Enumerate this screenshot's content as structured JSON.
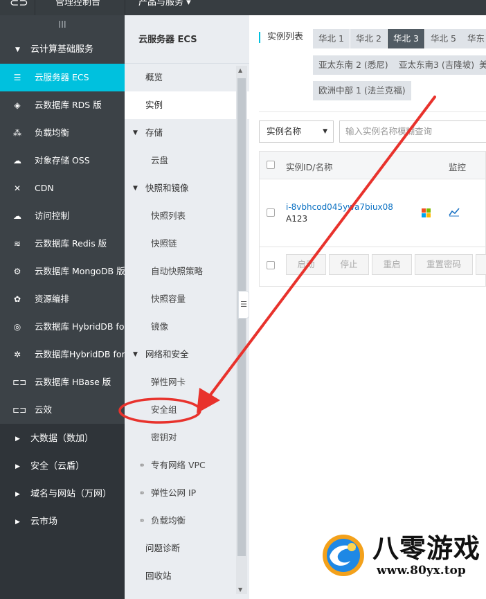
{
  "topbar": {
    "console": "管理控制台",
    "products": "产品与服务 ▾"
  },
  "sidebar": {
    "collapse_icon": "III",
    "group_title": "云计算基础服务",
    "items": [
      {
        "label": "云服务器 ECS",
        "icon": "server-icon",
        "glyph": "☰"
      },
      {
        "label": "云数据库 RDS 版",
        "icon": "database-icon",
        "glyph": "◈"
      },
      {
        "label": "负载均衡",
        "icon": "load-balance-icon",
        "glyph": "⁂"
      },
      {
        "label": "对象存储 OSS",
        "icon": "oss-icon",
        "glyph": "☁"
      },
      {
        "label": "CDN",
        "icon": "cdn-icon",
        "glyph": "✕"
      },
      {
        "label": "访问控制",
        "icon": "access-control-icon",
        "glyph": "☁"
      },
      {
        "label": "云数据库 Redis 版",
        "icon": "redis-icon",
        "glyph": "≋"
      },
      {
        "label": "云数据库 MongoDB 版",
        "icon": "mongodb-icon",
        "glyph": "⚙"
      },
      {
        "label": "资源编排",
        "icon": "orchestration-icon",
        "glyph": "✿"
      },
      {
        "label": "云数据库 HybridDB fo...",
        "icon": "hybriddb-icon",
        "glyph": "◎"
      },
      {
        "label": "云数据库HybridDB for...",
        "icon": "hybriddb2-icon",
        "glyph": "✲"
      },
      {
        "label": "云数据库 HBase 版",
        "icon": "hbase-icon",
        "glyph": "⊏⊐"
      },
      {
        "label": "云效",
        "icon": "yunxiao-icon",
        "glyph": "⊏⊐"
      }
    ],
    "groups": [
      "大数据（数加）",
      "安全（云盾）",
      "域名与网站（万网）",
      "云市场"
    ]
  },
  "prodnav": {
    "title": "云服务器 ECS",
    "overview": "概览",
    "instances": "实例",
    "storage": "存储",
    "disk": "云盘",
    "snapshot_group": "快照和镜像",
    "snapshot_list": "快照列表",
    "snapshot_chain": "快照链",
    "auto_snapshot": "自动快照策略",
    "snapshot_capacity": "快照容量",
    "image": "镜像",
    "network_group": "网络和安全",
    "eni": "弹性网卡",
    "security_group": "安全组",
    "keypair": "密钥对",
    "vpc": "专有网络 VPC",
    "eip": "弹性公网 IP",
    "slb": "负载均衡",
    "diagnosis": "问题诊断",
    "recycle": "回收站"
  },
  "main": {
    "list_title": "实例列表",
    "regions": [
      {
        "label": "华北 1",
        "active": false
      },
      {
        "label": "华北 2",
        "active": false
      },
      {
        "label": "华北 3",
        "active": true
      },
      {
        "label": "华北 5",
        "active": false
      },
      {
        "label": "华东",
        "active": false
      },
      {
        "label": "亚太东南 2 (悉尼)",
        "active": false
      },
      {
        "label": "亚太东南3 (吉隆坡)",
        "active": false
      },
      {
        "label": "美",
        "active": false
      },
      {
        "label": "欧洲中部 1 (法兰克福)",
        "active": false
      }
    ],
    "filter_select": "实例名称",
    "search_placeholder": "输入实例名称模糊查询",
    "table": {
      "col_id": "实例ID/名称",
      "col_monitor": "监控",
      "row_id": "i-8vbhcod045ywa7biux08",
      "row_name": "A123"
    },
    "buttons": [
      "启动",
      "停止",
      "重启",
      "重置密码"
    ]
  },
  "watermark": {
    "title": "八零游戏",
    "url": "www.80yx.top"
  },
  "colors": {
    "accent": "#00c1de",
    "annotation": "#e8322c"
  }
}
